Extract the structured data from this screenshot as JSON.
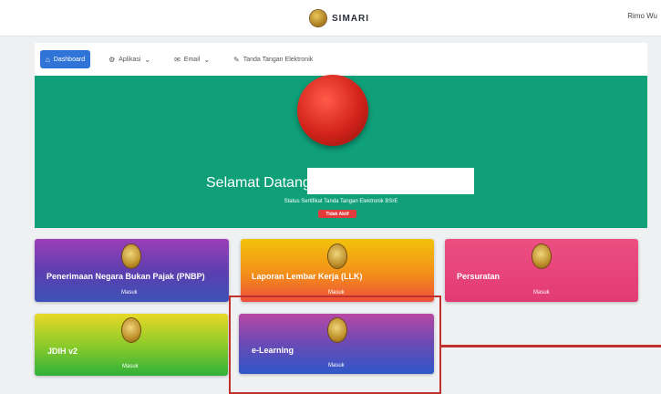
{
  "header": {
    "app_name": "SIMARI",
    "user_name": "Rimo Wu",
    "logo_icon": "coin-emblem-icon"
  },
  "navbar": {
    "items": [
      {
        "label": "Dashboard",
        "icon": "home-icon",
        "active": true
      },
      {
        "label": "Aplikasi",
        "icon": "grid-icon",
        "dropdown": true
      },
      {
        "label": "Email",
        "icon": "mail-icon",
        "dropdown": true
      },
      {
        "label": "Tanda Tangan Elektronik",
        "icon": "pen-icon"
      }
    ]
  },
  "hero": {
    "welcome": "Selamat Datang,",
    "status_text": "Status Sertifikat Tanda Tangan Elektronik BSrE",
    "status_badge": "Tidak Aktif"
  },
  "cards": [
    {
      "title": "Penerimaan Negara Bukan Pajak (PNBP)",
      "action": "Masuk"
    },
    {
      "title": "Laporan Lembar Kerja (LLK)",
      "action": "Masuk"
    },
    {
      "title": "Persuratan",
      "action": "Masuk"
    },
    {
      "title": "JDIH v2",
      "action": "Masuk"
    },
    {
      "title": "e-Learning",
      "action": "Masuk"
    }
  ],
  "colors": {
    "hero_bg": "#0f9f79",
    "accent": "#2f74d6",
    "highlight": "#c0302d"
  }
}
